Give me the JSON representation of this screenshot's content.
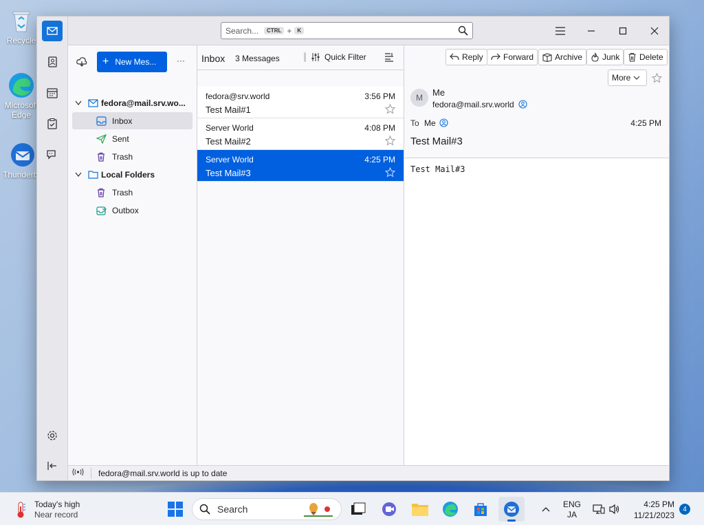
{
  "desktop": {
    "icons": [
      {
        "label": "Recycle"
      },
      {
        "label": "Microsoft Edge"
      },
      {
        "label": "Thunderbird"
      }
    ]
  },
  "titlebar": {
    "search_placeholder": "Search...",
    "kbd_ctrl": "CTRL",
    "kbd_plus": "+",
    "kbd_k": "K"
  },
  "folder_pane": {
    "new_message_label": "New Mes...",
    "more_label": "···",
    "account": "fedora@mail.srv.wo...",
    "folders": [
      {
        "label": "Inbox"
      },
      {
        "label": "Sent"
      },
      {
        "label": "Trash"
      }
    ],
    "local_folders": "Local Folders",
    "local_items": [
      {
        "label": "Trash"
      },
      {
        "label": "Outbox"
      }
    ]
  },
  "message_list": {
    "folder_title": "Inbox",
    "count": "3 Messages",
    "quick_filter": "Quick Filter",
    "messages": [
      {
        "from": "fedora@srv.world",
        "time": "3:56 PM",
        "subject": "Test Mail#1"
      },
      {
        "from": "Server World",
        "time": "4:08 PM",
        "subject": "Test Mail#2"
      },
      {
        "from": "Server World",
        "time": "4:25 PM",
        "subject": "Test Mail#3"
      }
    ]
  },
  "reader": {
    "buttons": {
      "reply": "Reply",
      "forward": "Forward",
      "archive": "Archive",
      "junk": "Junk",
      "delete": "Delete",
      "more": "More"
    },
    "avatar_initial": "M",
    "from_name": "Me",
    "from_email": "fedora@mail.srv.world",
    "to_label": "To",
    "to_value": "Me",
    "time": "4:25 PM",
    "subject": "Test Mail#3",
    "body": "Test Mail#3"
  },
  "status": {
    "text": "fedora@mail.srv.world is up to date"
  },
  "taskbar": {
    "weather_title": "Today's high",
    "weather_sub": "Near record",
    "search_label": "Search",
    "lang_top": "ENG",
    "lang_bottom": "JA",
    "clock_time": "4:25 PM",
    "clock_date": "11/21/2023",
    "notification_count": "4"
  },
  "colors": {
    "accent": "#0061e0",
    "selection": "#0060df"
  }
}
